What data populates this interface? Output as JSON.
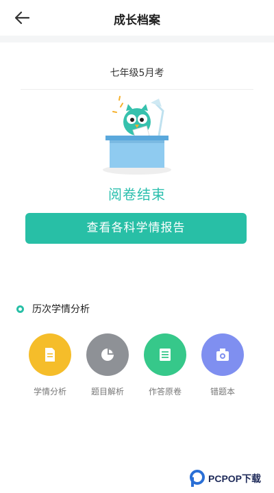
{
  "header": {
    "title": "成长档案",
    "back_icon": "arrow-left-icon"
  },
  "exam": {
    "name": "七年级5月考"
  },
  "illustration": {
    "icon": "owl-at-desk-illustration"
  },
  "status": {
    "text": "阅卷结束"
  },
  "report_button": {
    "label": "查看各科学情报告"
  },
  "history": {
    "title": "历次学情分析",
    "items": [
      {
        "label": "学情分析",
        "icon": "document-icon",
        "color": "#f5bd2a"
      },
      {
        "label": "题目解析",
        "icon": "pie-chart-icon",
        "color": "#8e9196"
      },
      {
        "label": "作答原卷",
        "icon": "list-icon",
        "color": "#36c88a"
      },
      {
        "label": "错题本",
        "icon": "camera-icon",
        "color": "#7f8ff0"
      }
    ]
  },
  "watermark": {
    "text": "PCPOP下载"
  },
  "colors": {
    "accent": "#28bfa6",
    "status_text": "#2cbfae"
  }
}
